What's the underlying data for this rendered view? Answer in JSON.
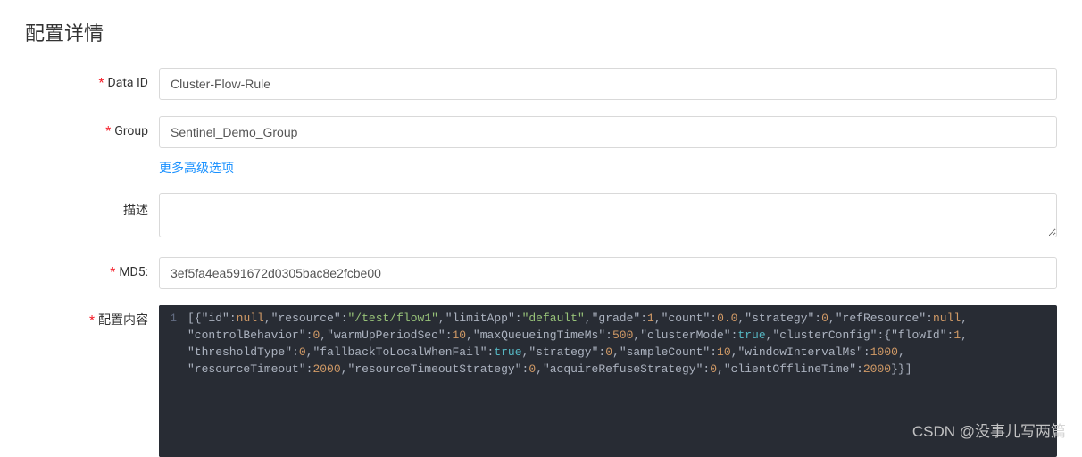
{
  "page_title": "配置详情",
  "labels": {
    "data_id": "Data ID",
    "group": "Group",
    "description": "描述",
    "md5": "MD5:",
    "content": "配置内容"
  },
  "fields": {
    "data_id": "Cluster-Flow-Rule",
    "group": "Sentinel_Demo_Group",
    "description": "",
    "md5": "3ef5fa4ea591672d0305bac8e2fcbe00"
  },
  "more_options_link": "更多高级选项",
  "editor": {
    "line_number": "1",
    "tokens": [
      {
        "t": "p",
        "v": "[{"
      },
      {
        "t": "key",
        "v": "\"id\""
      },
      {
        "t": "p",
        "v": ":"
      },
      {
        "t": "null",
        "v": "null"
      },
      {
        "t": "p",
        "v": ","
      },
      {
        "t": "key",
        "v": "\"resource\""
      },
      {
        "t": "p",
        "v": ":"
      },
      {
        "t": "str",
        "v": "\"/test/flow1\""
      },
      {
        "t": "p",
        "v": ","
      },
      {
        "t": "key",
        "v": "\"limitApp\""
      },
      {
        "t": "p",
        "v": ":"
      },
      {
        "t": "str",
        "v": "\"default\""
      },
      {
        "t": "p",
        "v": ","
      },
      {
        "t": "key",
        "v": "\"grade\""
      },
      {
        "t": "p",
        "v": ":"
      },
      {
        "t": "num",
        "v": "1"
      },
      {
        "t": "p",
        "v": ","
      },
      {
        "t": "key",
        "v": "\"count\""
      },
      {
        "t": "p",
        "v": ":"
      },
      {
        "t": "num",
        "v": "0.0"
      },
      {
        "t": "p",
        "v": ","
      },
      {
        "t": "key",
        "v": "\"strategy\""
      },
      {
        "t": "p",
        "v": ":"
      },
      {
        "t": "num",
        "v": "0"
      },
      {
        "t": "p",
        "v": ","
      },
      {
        "t": "key",
        "v": "\"refResource\""
      },
      {
        "t": "p",
        "v": ":"
      },
      {
        "t": "null",
        "v": "null"
      },
      {
        "t": "p",
        "v": ","
      },
      {
        "t": "br"
      },
      {
        "t": "key",
        "v": "\"controlBehavior\""
      },
      {
        "t": "p",
        "v": ":"
      },
      {
        "t": "num",
        "v": "0"
      },
      {
        "t": "p",
        "v": ","
      },
      {
        "t": "key",
        "v": "\"warmUpPeriodSec\""
      },
      {
        "t": "p",
        "v": ":"
      },
      {
        "t": "num",
        "v": "10"
      },
      {
        "t": "p",
        "v": ","
      },
      {
        "t": "key",
        "v": "\"maxQueueingTimeMs\""
      },
      {
        "t": "p",
        "v": ":"
      },
      {
        "t": "num",
        "v": "500"
      },
      {
        "t": "p",
        "v": ","
      },
      {
        "t": "key",
        "v": "\"clusterMode\""
      },
      {
        "t": "p",
        "v": ":"
      },
      {
        "t": "bool",
        "v": "true"
      },
      {
        "t": "p",
        "v": ","
      },
      {
        "t": "key",
        "v": "\"clusterConfig\""
      },
      {
        "t": "p",
        "v": ":{"
      },
      {
        "t": "key",
        "v": "\"flowId\""
      },
      {
        "t": "p",
        "v": ":"
      },
      {
        "t": "num",
        "v": "1"
      },
      {
        "t": "p",
        "v": ","
      },
      {
        "t": "br"
      },
      {
        "t": "key",
        "v": "\"thresholdType\""
      },
      {
        "t": "p",
        "v": ":"
      },
      {
        "t": "num",
        "v": "0"
      },
      {
        "t": "p",
        "v": ","
      },
      {
        "t": "key",
        "v": "\"fallbackToLocalWhenFail\""
      },
      {
        "t": "p",
        "v": ":"
      },
      {
        "t": "bool",
        "v": "true"
      },
      {
        "t": "p",
        "v": ","
      },
      {
        "t": "key",
        "v": "\"strategy\""
      },
      {
        "t": "p",
        "v": ":"
      },
      {
        "t": "num",
        "v": "0"
      },
      {
        "t": "p",
        "v": ","
      },
      {
        "t": "key",
        "v": "\"sampleCount\""
      },
      {
        "t": "p",
        "v": ":"
      },
      {
        "t": "num",
        "v": "10"
      },
      {
        "t": "p",
        "v": ","
      },
      {
        "t": "key",
        "v": "\"windowIntervalMs\""
      },
      {
        "t": "p",
        "v": ":"
      },
      {
        "t": "num",
        "v": "1000"
      },
      {
        "t": "p",
        "v": ","
      },
      {
        "t": "br"
      },
      {
        "t": "key",
        "v": "\"resourceTimeout\""
      },
      {
        "t": "p",
        "v": ":"
      },
      {
        "t": "num",
        "v": "2000"
      },
      {
        "t": "p",
        "v": ","
      },
      {
        "t": "key",
        "v": "\"resourceTimeoutStrategy\""
      },
      {
        "t": "p",
        "v": ":"
      },
      {
        "t": "num",
        "v": "0"
      },
      {
        "t": "p",
        "v": ","
      },
      {
        "t": "key",
        "v": "\"acquireRefuseStrategy\""
      },
      {
        "t": "p",
        "v": ":"
      },
      {
        "t": "num",
        "v": "0"
      },
      {
        "t": "p",
        "v": ","
      },
      {
        "t": "key",
        "v": "\"clientOfflineTime\""
      },
      {
        "t": "p",
        "v": ":"
      },
      {
        "t": "num",
        "v": "2000"
      },
      {
        "t": "p",
        "v": "}}]"
      }
    ]
  },
  "watermark": "CSDN @没事儿写两篇"
}
